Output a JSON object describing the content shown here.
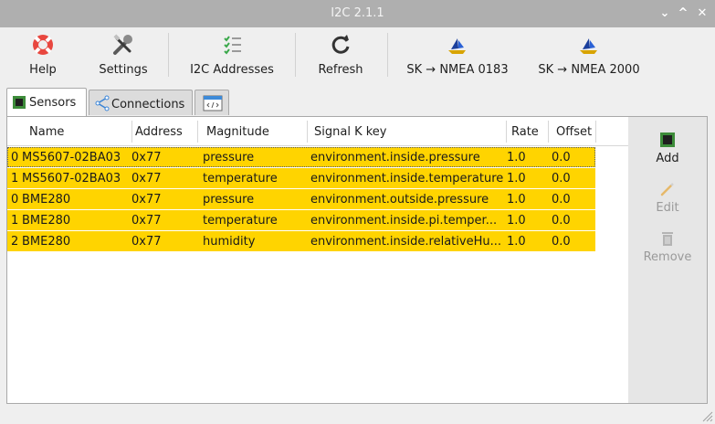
{
  "window": {
    "title": "I2C 2.1.1",
    "controls": [
      "⌄",
      "^",
      "✕"
    ]
  },
  "toolbar": {
    "help": "Help",
    "settings": "Settings",
    "i2c_addresses": "I2C Addresses",
    "refresh": "Refresh",
    "sk_nmea0183": "SK → NMEA 0183",
    "sk_nmea2000": "SK → NMEA 2000"
  },
  "tabs": {
    "sensors": "Sensors",
    "connections": "Connections"
  },
  "table": {
    "columns": [
      "Name",
      "Address",
      "Magnitude",
      "Signal K key",
      "Rate",
      "Offset"
    ],
    "rows": [
      {
        "index": "0",
        "name": "MS5607-02BA03",
        "address": "0x77",
        "magnitude": "pressure",
        "key": "environment.inside.pressure",
        "rate": "1.0",
        "offset": "0.0"
      },
      {
        "index": "1",
        "name": "MS5607-02BA03",
        "address": "0x77",
        "magnitude": "temperature",
        "key": "environment.inside.temperature",
        "rate": "1.0",
        "offset": "0.0"
      },
      {
        "index": "0",
        "name": "BME280",
        "address": "0x77",
        "magnitude": "pressure",
        "key": "environment.outside.pressure",
        "rate": "1.0",
        "offset": "0.0"
      },
      {
        "index": "1",
        "name": "BME280",
        "address": "0x77",
        "magnitude": "temperature",
        "key": "environment.inside.pi.temper...",
        "rate": "1.0",
        "offset": "0.0"
      },
      {
        "index": "2",
        "name": "BME280",
        "address": "0x77",
        "magnitude": "humidity",
        "key": "environment.inside.relativeHu...",
        "rate": "1.0",
        "offset": "0.0"
      }
    ]
  },
  "side": {
    "add": "Add",
    "edit": "Edit",
    "remove": "Remove"
  },
  "colors": {
    "row_highlight": "#ffd400",
    "titlebar": "#afafaf",
    "accent": "#2196f3"
  }
}
